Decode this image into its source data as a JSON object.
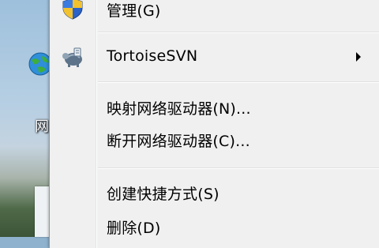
{
  "desktop": {
    "icon_label": "网"
  },
  "menu": {
    "items": [
      {
        "label": "管理(G)",
        "icon": "shield-icon"
      },
      {
        "label": "TortoiseSVN",
        "icon": "tortoise-svn-icon",
        "has_submenu": true
      },
      {
        "label": "映射网络驱动器(N)..."
      },
      {
        "label": "断开网络驱动器(C)..."
      },
      {
        "label": "创建快捷方式(S)"
      },
      {
        "label": "删除(D)"
      }
    ]
  }
}
